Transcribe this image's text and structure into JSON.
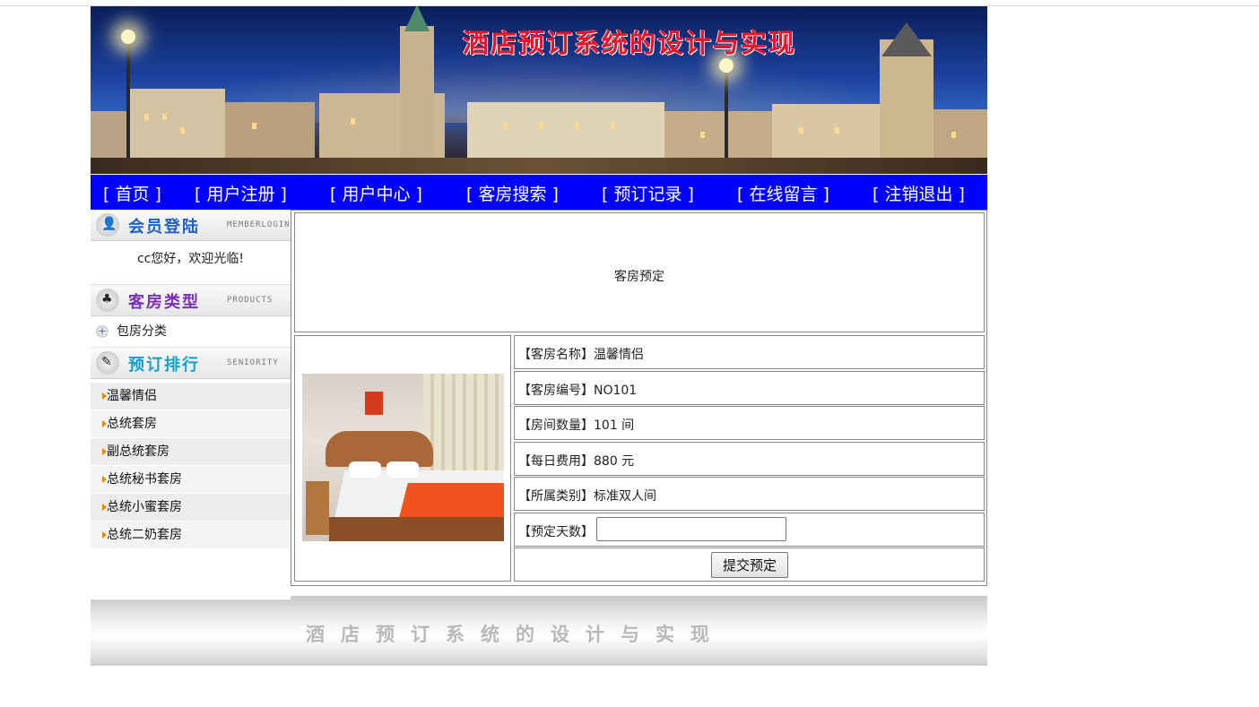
{
  "banner": {
    "title": "酒店预订系统的设计与实现"
  },
  "nav": [
    "[ 首页 ]",
    "[ 用户注册 ]",
    "[ 用户中心 ]",
    "[ 客房搜索 ]",
    "[ 预订记录 ]",
    "[ 在线留言 ]",
    "[ 注销退出 ]"
  ],
  "sidebar": {
    "member": {
      "title": "会员登陆",
      "sub": "MEMBERLOGIN",
      "welcome": "cc您好，欢迎光临!"
    },
    "products": {
      "title": "客房类型",
      "sub": "PRODUCTS",
      "category": "包房分类"
    },
    "seniority": {
      "title": "预订排行",
      "sub": "SENIORITY",
      "items": [
        "温馨情侣",
        "总统套房",
        "副总统套房",
        "总统秘书套房",
        "总统小蜜套房",
        "总统二奶套房"
      ]
    }
  },
  "main": {
    "header": "客房预定",
    "fields": {
      "name": "【客房名称】温馨情侣",
      "code": "【客房编号】NO101",
      "count": "【房间数量】101 间",
      "price": "【每日费用】880 元",
      "type": "【所属类别】标准双人间",
      "days_label": "【预定天数】"
    },
    "days_value": "",
    "submit_label": "提交预定"
  },
  "footer": {
    "text": "酒店预订系统的设计与实现"
  },
  "colors": {
    "nav_bg": "#0000ff",
    "title_red": "#e8142a"
  }
}
